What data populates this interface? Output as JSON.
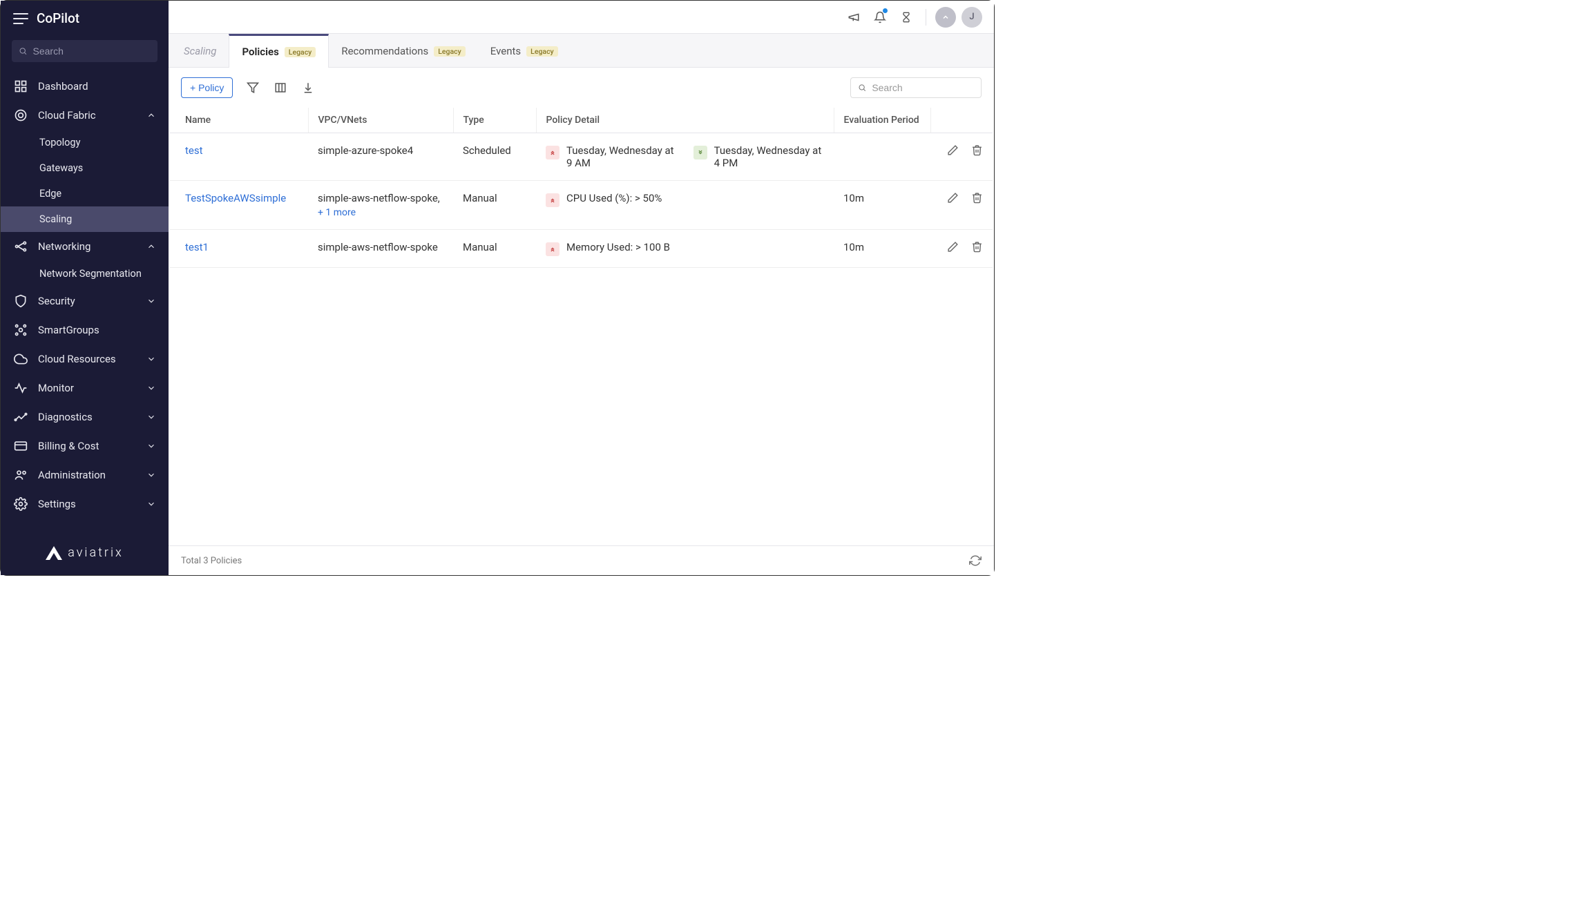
{
  "brand": "CoPilot",
  "sidebar_search_placeholder": "Search",
  "nav": {
    "dashboard": "Dashboard",
    "cloud_fabric": "Cloud Fabric",
    "cf_sub": {
      "topology": "Topology",
      "gateways": "Gateways",
      "edge": "Edge",
      "scaling": "Scaling"
    },
    "networking": "Networking",
    "net_sub": {
      "segmentation": "Network Segmentation"
    },
    "security": "Security",
    "smartgroups": "SmartGroups",
    "cloud_resources": "Cloud Resources",
    "monitor": "Monitor",
    "diagnostics": "Diagnostics",
    "billing": "Billing & Cost",
    "administration": "Administration",
    "settings": "Settings"
  },
  "footer_brand": "aviatrix",
  "tabs": {
    "scaling": "Scaling",
    "policies": "Policies",
    "recommendations": "Recommendations",
    "events": "Events",
    "legacy_badge": "Legacy"
  },
  "toolbar": {
    "add_policy": "+  Policy",
    "search_placeholder": "Search"
  },
  "columns": {
    "name": "Name",
    "vpc": "VPC/VNets",
    "type": "Type",
    "policy_detail": "Policy Detail",
    "eval_period": "Evaluation Period"
  },
  "rows": [
    {
      "name": "test",
      "vpc": "simple-azure-spoke4",
      "vpc_extra": "",
      "type": "Scheduled",
      "detail_up": "Tuesday, Wednesday at 9 AM",
      "detail_down": "Tuesday, Wednesday at 4 PM",
      "eval": ""
    },
    {
      "name": "TestSpokeAWSsimple",
      "vpc": "simple-aws-netflow-spoke,",
      "vpc_extra": "+ 1 more",
      "type": "Manual",
      "detail_up": "CPU Used (%): > 50%",
      "detail_down": "",
      "eval": "10m"
    },
    {
      "name": "test1",
      "vpc": "simple-aws-netflow-spoke",
      "vpc_extra": "",
      "type": "Manual",
      "detail_up": "Memory Used: > 100 B",
      "detail_down": "",
      "eval": "10m"
    }
  ],
  "footer_total": "Total 3 Policies",
  "avatar_initial": "J"
}
